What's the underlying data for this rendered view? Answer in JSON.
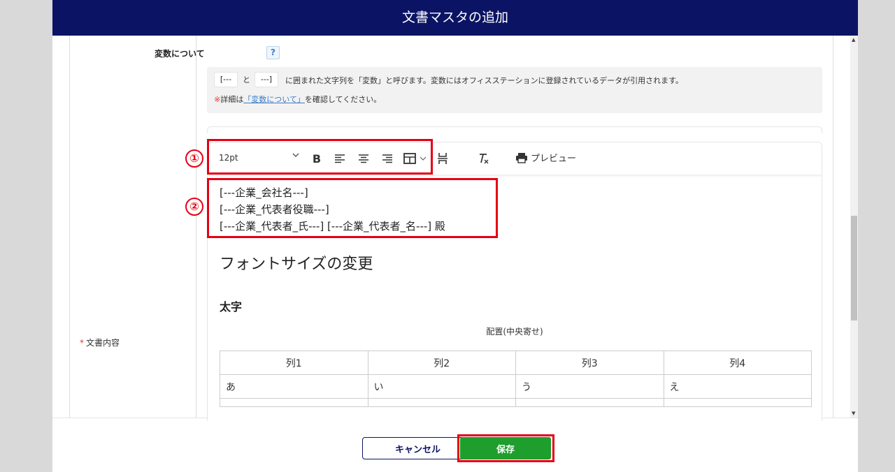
{
  "header": {
    "title": "文書マスタの追加"
  },
  "form": {
    "field_label": "文書内容",
    "required_mark": "*"
  },
  "variables": {
    "title": "変数について",
    "help_icon": "?",
    "token_open": "[---",
    "and_text": "と",
    "token_close": "---]",
    "description": "に囲まれた文字列を「変数」と呼びます。変数にはオフィスステーションに登録されているデータが引用されます。",
    "note_mark": "※",
    "note_prefix": "詳細は",
    "note_link": "「変数について」",
    "note_suffix": "を確認してください。"
  },
  "toolbar": {
    "font_size": "12pt",
    "icons": [
      "bold-icon",
      "align-left-icon",
      "align-center-icon",
      "align-right-icon",
      "table-icon",
      "page-break-icon",
      "clear-format-icon",
      "print-icon"
    ],
    "preview_label": "プレビュー"
  },
  "editor": {
    "variable_lines": [
      "[---企業_会社名---]",
      "[---企業_代表者役職---]",
      "[---企業_代表者_氏---] [---企業_代表者_名---] 殿"
    ],
    "heading_font_size": "フォントサイズの変更",
    "heading_bold": "太字",
    "center_text": "配置(中央寄せ)",
    "table": {
      "headers": [
        "列1",
        "列2",
        "列3",
        "列4"
      ],
      "rows": [
        [
          "あ",
          "い",
          "う",
          "え"
        ]
      ]
    }
  },
  "annotations": {
    "marker_1": "①",
    "marker_2": "②",
    "highlight_color": "#e60012"
  },
  "footer": {
    "cancel_label": "キャンセル",
    "save_label": "保存"
  }
}
